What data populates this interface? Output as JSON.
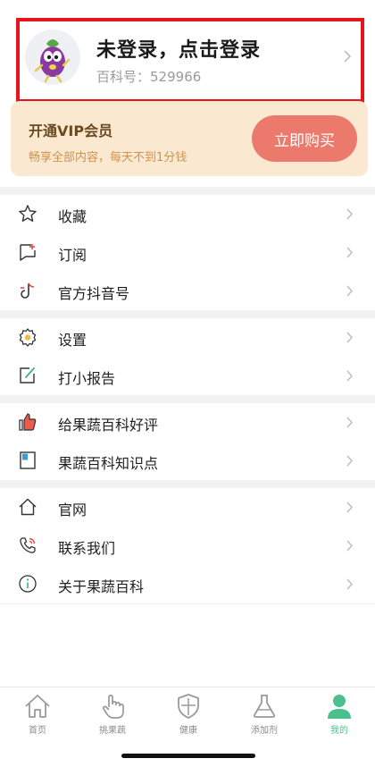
{
  "profile": {
    "name": "未登录，点击登录",
    "id_label": "百科号：",
    "id_value": "529966"
  },
  "vip": {
    "title": "开通VIP会员",
    "subtitle": "畅享全部内容，每天不到1分钱",
    "button": "立即购买"
  },
  "menu": {
    "favorites": "收藏",
    "subscribe": "订阅",
    "douyin": "官方抖音号",
    "settings": "设置",
    "report": "打小报告",
    "rate": "给果蔬百科好评",
    "knowledge": "果蔬百科知识点",
    "website": "官网",
    "contact": "联系我们",
    "about": "关于果蔬百科"
  },
  "tabs": {
    "home": "首页",
    "pick": "挑果蔬",
    "health": "健康",
    "additives": "添加剂",
    "mine": "我的"
  },
  "colors": {
    "accent_green": "#4cbf8e",
    "vip_button": "#ec7a6c",
    "vip_bg": "#fae8d1",
    "highlight_border": "#e8141b"
  }
}
